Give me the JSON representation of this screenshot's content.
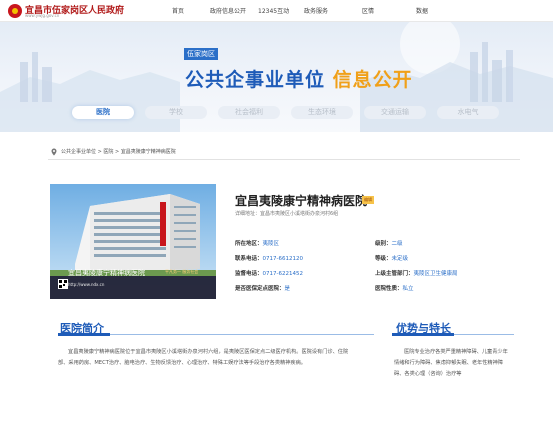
{
  "site": {
    "name": "宜昌市伍家岗区人民政府",
    "url": "www.ywjg.gov.cn",
    "nav": [
      "首页",
      "政府信息公开",
      "12345互动",
      "政务服务",
      "区情",
      "数据"
    ]
  },
  "hero": {
    "badge": "伍家岗区",
    "title_main": "公共企事业单位",
    "title_accent": "信息公开"
  },
  "tabs": {
    "active": "医院",
    "items": [
      "医院",
      "学校",
      "社会福利",
      "生态环境",
      "交通运输",
      "水电气"
    ]
  },
  "breadcrumb": "公共企事业单位 > 医院 > 宜昌夷陵康宁精神病医院",
  "photo": {
    "title": "宜昌夷陵康宁精神病医院",
    "slogan": "平凡务一  服务社会",
    "url": "http://www.ndx.cn"
  },
  "hospital": {
    "name": "宜昌夷陵康宁精神病医院",
    "tag": "编辑",
    "address": "详细地址：宜昌市夷陵区小溪塔街办泉河村6组",
    "info": {
      "district_label": "所在地区：",
      "district": "夷陵区",
      "level_label": "级别：",
      "level": "二级",
      "phone_label": "联系电话：",
      "phone": "0717-6612120",
      "grade_label": "等级：",
      "grade": "未定级",
      "supervise_label": "监督电话：",
      "supervise": "0717-6221452",
      "authority_label": "上级主管部门：",
      "authority": "夷陵区卫生健康局",
      "insurance_label": "是否医保定点医院：",
      "insurance": "是",
      "nature_label": "医院性质：",
      "nature": "私立"
    }
  },
  "intro": {
    "title": "医院简介",
    "body": "宜昌夷陵康宁精神病医院位于宜昌市夷陵区小溪塔街办泉河村六组，是夷陵区医保定点二级医疗机构。医院设有门诊、住院部、采用药房、MECT治疗、脑电治疗、生物反馈治疗、心理治疗、特殊工娱疗法等手段治疗各类精神疾病。"
  },
  "features": {
    "title": "优势与特长",
    "body": "医院专业治疗各类严重精神障碍、儿童青少年情绪和行为障碍、焦虑抑郁失眠、老年性精神障碍、各类心理（咨询）治疗等"
  },
  "colors": {
    "brand_blue": "#1e5bb8",
    "accent_orange": "#f0a019",
    "gov_red": "#c8161d"
  }
}
